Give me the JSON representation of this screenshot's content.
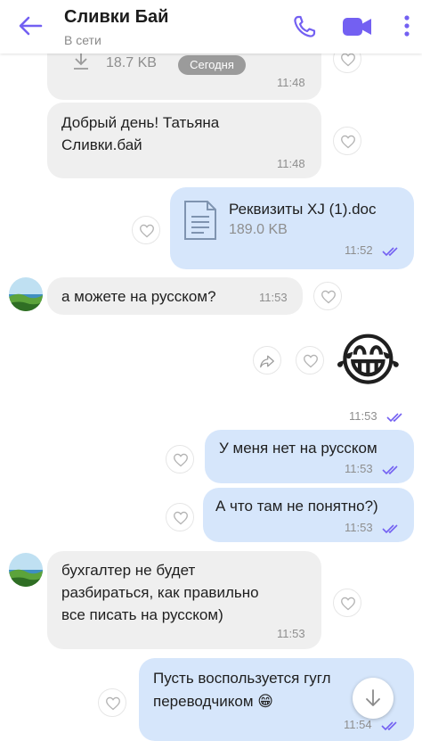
{
  "header": {
    "title": "Сливки Бай",
    "status": "В сети",
    "accent_color": "#7360f2"
  },
  "date_pill": "Сегодня",
  "messages": [
    {
      "side": "in",
      "file_size": "18.7 KB",
      "time": "11:48"
    },
    {
      "side": "in",
      "lines": [
        "Добрый день! Татьяна",
        "Сливки.бай"
      ],
      "time": "11:48"
    },
    {
      "side": "out",
      "file_name": "Реквизиты XJ (1).doc",
      "file_size": "189.0 KB",
      "time": "11:52",
      "status": "read"
    },
    {
      "side": "in",
      "text": "а можете на русском?",
      "time": "11:53"
    },
    {
      "side": "out",
      "emoji": "😂",
      "time": "11:53",
      "status": "read"
    },
    {
      "side": "out",
      "text": "У меня нет на русском",
      "time": "11:53",
      "status": "read"
    },
    {
      "side": "out",
      "text": "А что там не понятно?)",
      "time": "11:53",
      "status": "read"
    },
    {
      "side": "in",
      "lines": [
        "бухгалтер не будет",
        "разбираться, как правильно",
        "все писать на русском)"
      ],
      "time": "11:53"
    },
    {
      "side": "out",
      "lines": [
        "Пусть воспользуется гугл",
        "переводчиком 😁"
      ],
      "time": "11:54",
      "status": "read"
    }
  ],
  "icons": {
    "back": "arrow-left-icon",
    "call": "phone-icon",
    "video": "video-camera-icon",
    "menu": "more-vertical-icon",
    "like": "heart-icon",
    "share": "share-icon",
    "file": "document-icon",
    "download": "download-icon",
    "scroll": "arrow-down-icon",
    "read": "double-check-icon"
  },
  "colors": {
    "incoming_bubble": "#efefef",
    "outgoing_bubble": "#d6e6fb",
    "read_ticks": "#7360f2"
  }
}
